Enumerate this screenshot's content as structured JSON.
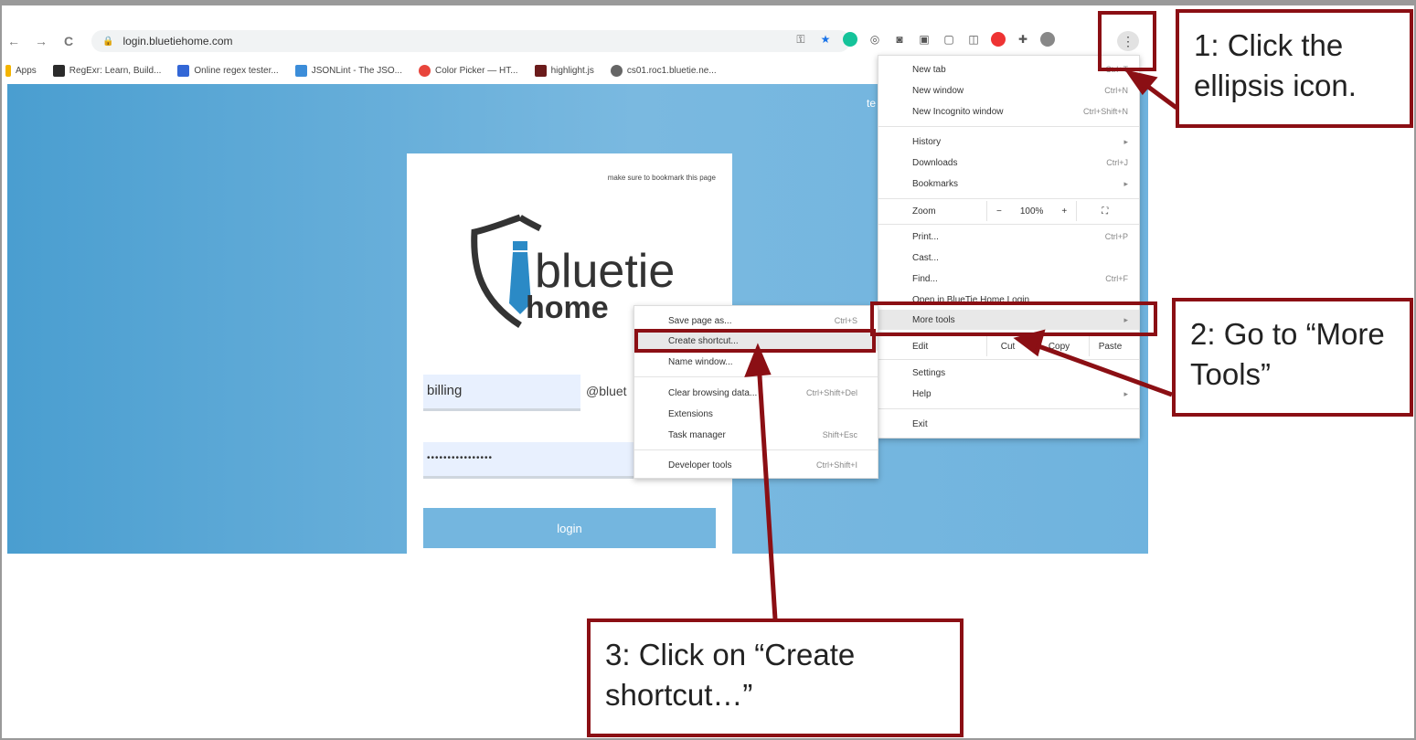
{
  "browser": {
    "url": "login.bluetiehome.com",
    "nav": {
      "back": "←",
      "forward": "→",
      "reload": "C"
    },
    "menu_icon": "⋮"
  },
  "bookmarks": [
    {
      "label": "Apps",
      "color": "#f4b400"
    },
    {
      "label": "RegExr: Learn, Build...",
      "color": "#2b2b2b"
    },
    {
      "label": "Online regex tester...",
      "color": "#3367d6"
    },
    {
      "label": "JSONLint - The JSO...",
      "color": "#3c8dd9"
    },
    {
      "label": "Color Picker — HT...",
      "color": "#e8453c"
    },
    {
      "label": "highlight.js",
      "color": "#6b1b1b"
    },
    {
      "label": "cs01.roc1.bluetie.ne...",
      "color": "#666666"
    }
  ],
  "page": {
    "bookmark_note": "make sure to bookmark this page",
    "logo": {
      "word1": "bluetie",
      "word2": "home"
    },
    "username": "billing",
    "domain_suffix": "@bluet",
    "password_mask": "••••••••••••••••",
    "login_label": "login",
    "right_stub": "te"
  },
  "chrome_menu": {
    "items": [
      {
        "label": "New tab",
        "shortcut": "Ctrl+T"
      },
      {
        "label": "New window",
        "shortcut": "Ctrl+N"
      },
      {
        "label": "New Incognito window",
        "shortcut": "Ctrl+Shift+N"
      },
      {
        "label": "History",
        "shortcut": "▸"
      },
      {
        "label": "Downloads",
        "shortcut": "Ctrl+J"
      },
      {
        "label": "Bookmarks",
        "shortcut": "▸"
      },
      {
        "label": "Zoom",
        "zoom_minus": "−",
        "zoom_value": "100%",
        "zoom_plus": "+",
        "fullscreen": "⛶"
      },
      {
        "label": "Print...",
        "shortcut": "Ctrl+P"
      },
      {
        "label": "Cast...",
        "shortcut": ""
      },
      {
        "label": "Find...",
        "shortcut": "Ctrl+F"
      },
      {
        "label": "Open in BlueTie Home Login",
        "shortcut": ""
      },
      {
        "label": "More tools",
        "shortcut": "▸"
      },
      {
        "label": "Edit",
        "cut": "Cut",
        "copy": "Copy",
        "paste": "Paste"
      },
      {
        "label": "Settings",
        "shortcut": ""
      },
      {
        "label": "Help",
        "shortcut": "▸"
      },
      {
        "label": "Exit",
        "shortcut": ""
      }
    ]
  },
  "more_tools_submenu": {
    "items": [
      {
        "label": "Save page as...",
        "shortcut": "Ctrl+S"
      },
      {
        "label": "Create shortcut...",
        "shortcut": ""
      },
      {
        "label": "Name window...",
        "shortcut": ""
      },
      {
        "label": "Clear browsing data...",
        "shortcut": "Ctrl+Shift+Del"
      },
      {
        "label": "Extensions",
        "shortcut": ""
      },
      {
        "label": "Task manager",
        "shortcut": "Shift+Esc"
      },
      {
        "label": "Developer tools",
        "shortcut": "Ctrl+Shift+I"
      }
    ]
  },
  "callouts": {
    "step1": "1: Click the ellipsis icon.",
    "step2": "2: Go to “More Tools”",
    "step3": "3: Click on “Create shortcut…”"
  },
  "annotation_color": "#8b0f14"
}
